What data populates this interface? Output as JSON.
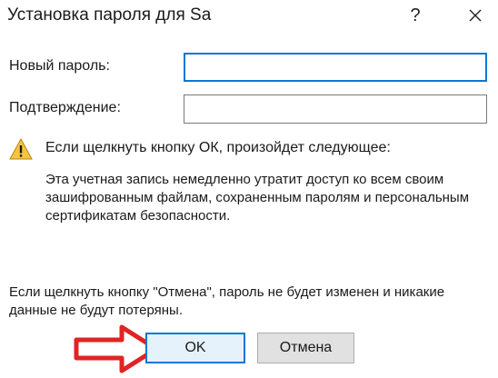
{
  "window": {
    "title": "Установка пароля для Sa",
    "help_glyph": "?",
    "icons": {
      "close": "close-icon",
      "warning": "warning-icon",
      "arrow": "arrow-right-icon"
    }
  },
  "form": {
    "new_password_label": "Новый пароль:",
    "new_password_value": "",
    "confirm_label": "Подтверждение:",
    "confirm_value": ""
  },
  "warning": {
    "heading": "Если щелкнуть кнопку ОК, произойдет следующее:",
    "body": "Эта учетная запись немедленно утратит доступ ко всем своим зашифрованным файлам, сохраненным паролям и персональным сертификатам безопасности."
  },
  "cancel_note": "Если щелкнуть кнопку \"Отмена\", пароль не будет изменен и никакие данные не будут потеряны.",
  "buttons": {
    "ok": "OK",
    "cancel": "Отмена"
  },
  "colors": {
    "accent": "#0078d7",
    "arrow": "#e02424",
    "warning_fill": "#f6c343"
  }
}
